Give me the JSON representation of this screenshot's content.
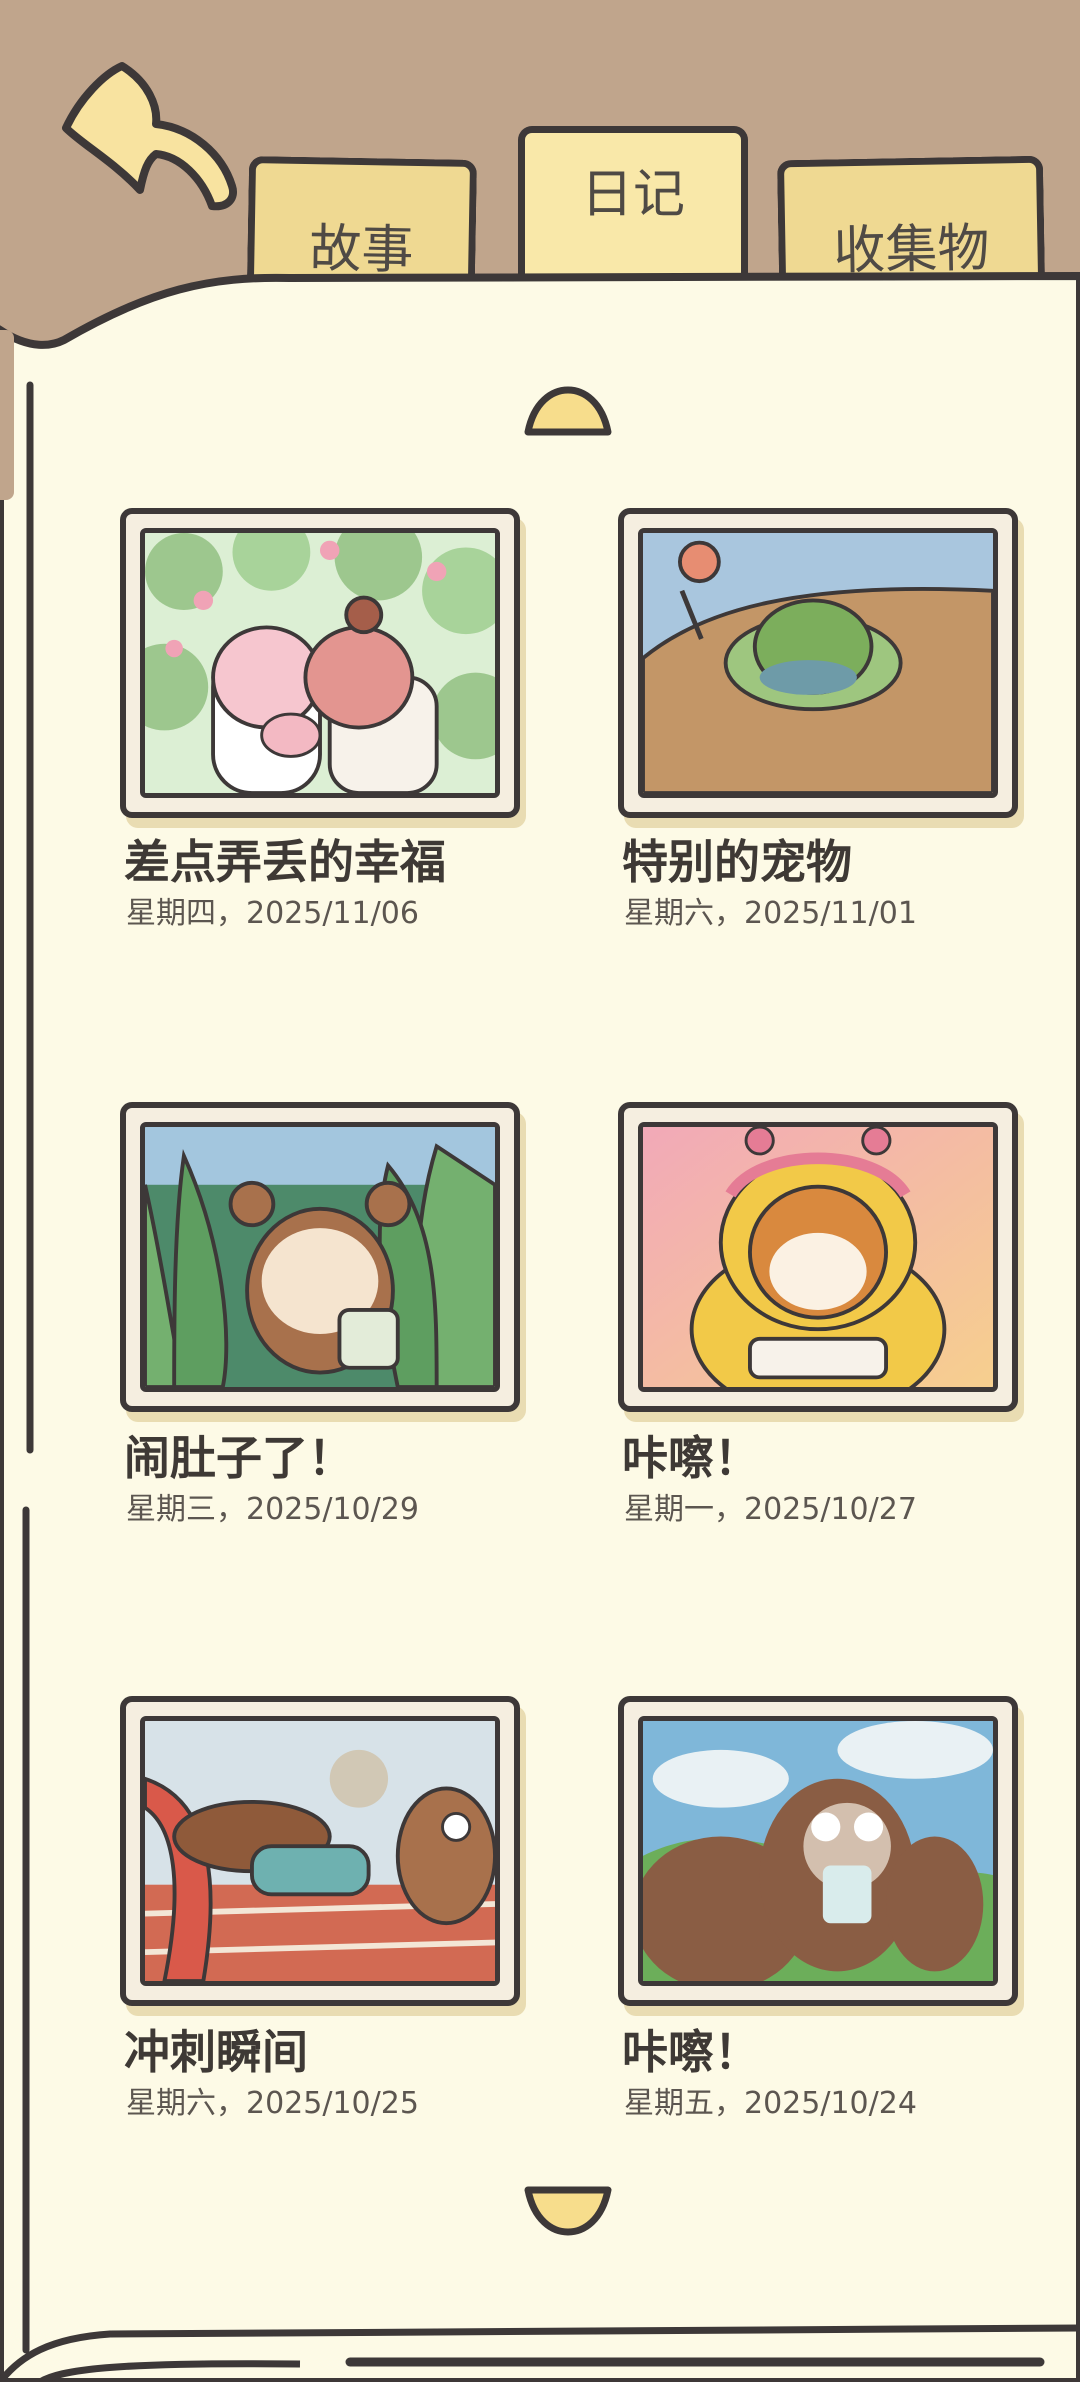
{
  "tabs": [
    {
      "label": "故事",
      "active": false
    },
    {
      "label": "日记",
      "active": true
    },
    {
      "label": "收集物",
      "active": false
    }
  ],
  "entries": [
    {
      "title": "差点弄丢的幸福",
      "date": "星期四，2025/11/06",
      "scene": "wedding"
    },
    {
      "title": "特别的宠物",
      "date": "星期六，2025/11/01",
      "scene": "pet"
    },
    {
      "title": "闹肚子了！",
      "date": "星期三，2025/10/29",
      "scene": "forest"
    },
    {
      "title": "咔嚓！",
      "date": "星期一，2025/10/27",
      "scene": "shiba"
    },
    {
      "title": "冲刺瞬间",
      "date": "星期六，2025/10/25",
      "scene": "race"
    },
    {
      "title": "咔嚓！",
      "date": "星期五，2025/10/24",
      "scene": "squirrel"
    }
  ],
  "colors": {
    "background": "#c0a58c",
    "page": "#fdfae6",
    "tab": "#efd992",
    "outline": "#3d3838"
  }
}
